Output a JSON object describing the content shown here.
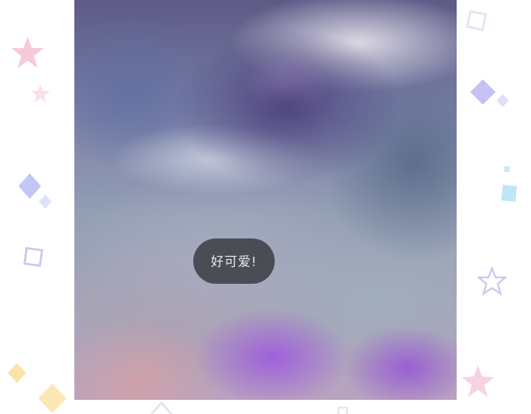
{
  "toast": {
    "message": "好可爱!"
  },
  "photo": {
    "description_icon": "blurred-image"
  },
  "colors": {
    "toast_background": "#37383e",
    "toast_text": "#e8e8ec",
    "star_pink": "#f7c9d9",
    "diamond_blue": "#c2c8f5",
    "diamond_yellow": "#fbe3a8",
    "square_cyan": "#bfe6f5"
  },
  "decorations": [
    "star-icon",
    "diamond-icon",
    "square-outline-icon",
    "star-outline-icon"
  ]
}
